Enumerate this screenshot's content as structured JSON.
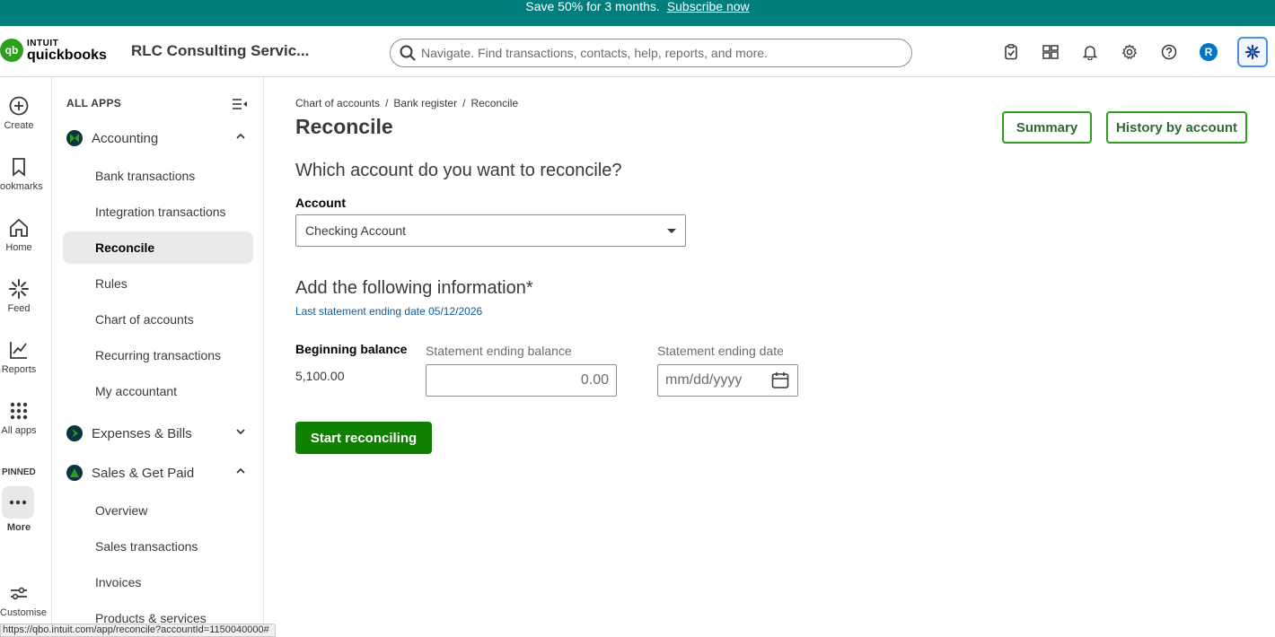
{
  "promo": {
    "text": "Save 50% for 3 months.",
    "link": "Subscribe now"
  },
  "header": {
    "logo_small": "INTUIT",
    "logo_main": "quickbooks",
    "logo_mark": "qb",
    "company": "RLC Consulting Servic...",
    "search_placeholder": "Navigate. Find transactions, contacts, help, reports, and more.",
    "avatar_initial": "R",
    "icons": [
      "tasks-icon",
      "apps-switch-icon",
      "bell-icon",
      "gear-icon",
      "help-icon",
      "avatar",
      "ai-assistant-icon"
    ]
  },
  "rail": {
    "items": [
      {
        "label": "Create",
        "icon": "plus-circle-icon"
      },
      {
        "label": "ookmarks",
        "icon": "bookmark-icon"
      },
      {
        "label": "Home",
        "icon": "home-icon"
      },
      {
        "label": "Feed",
        "icon": "feed-icon"
      },
      {
        "label": "Reports",
        "icon": "chart-icon"
      },
      {
        "label": "All apps",
        "icon": "grid-icon"
      }
    ],
    "pinned": "PINNED",
    "more": "More",
    "customise": "Customise"
  },
  "sidebar": {
    "all_apps": "ALL APPS",
    "accounting": {
      "label": "Accounting",
      "items": [
        "Bank transactions",
        "Integration transactions",
        "Reconcile",
        "Rules",
        "Chart of accounts",
        "Recurring transactions",
        "My accountant"
      ]
    },
    "expenses": {
      "label": "Expenses & Bills"
    },
    "sales": {
      "label": "Sales & Get Paid",
      "items": [
        "Overview",
        "Sales transactions",
        "Invoices",
        "Products & services"
      ]
    }
  },
  "main": {
    "breadcrumbs": [
      "Chart of accounts",
      "Bank register",
      "Reconcile"
    ],
    "title": "Reconcile",
    "summary_btn": "Summary",
    "history_btn": "History by account",
    "question1": "Which account do you want to reconcile?",
    "account_label": "Account",
    "account_value": "Checking Account",
    "question2": "Add the following information*",
    "last_statement": "Last statement ending date 05/12/2026",
    "beginning_balance_label": "Beginning balance",
    "beginning_balance_value": "5,100.00",
    "ending_balance_label": "Statement ending balance",
    "ending_balance_placeholder": "0.00",
    "ending_date_label": "Statement ending date",
    "ending_date_placeholder": "mm/dd/yyyy",
    "start_btn": "Start reconciling"
  },
  "status_url": "https://qbo.intuit.com/app/reconcile?accountId=1150040000#",
  "colors": {
    "brand_green": "#2ca01c",
    "primary_button": "#108000",
    "promo_teal": "#007e7d",
    "link_blue": "#0d5b9e"
  }
}
